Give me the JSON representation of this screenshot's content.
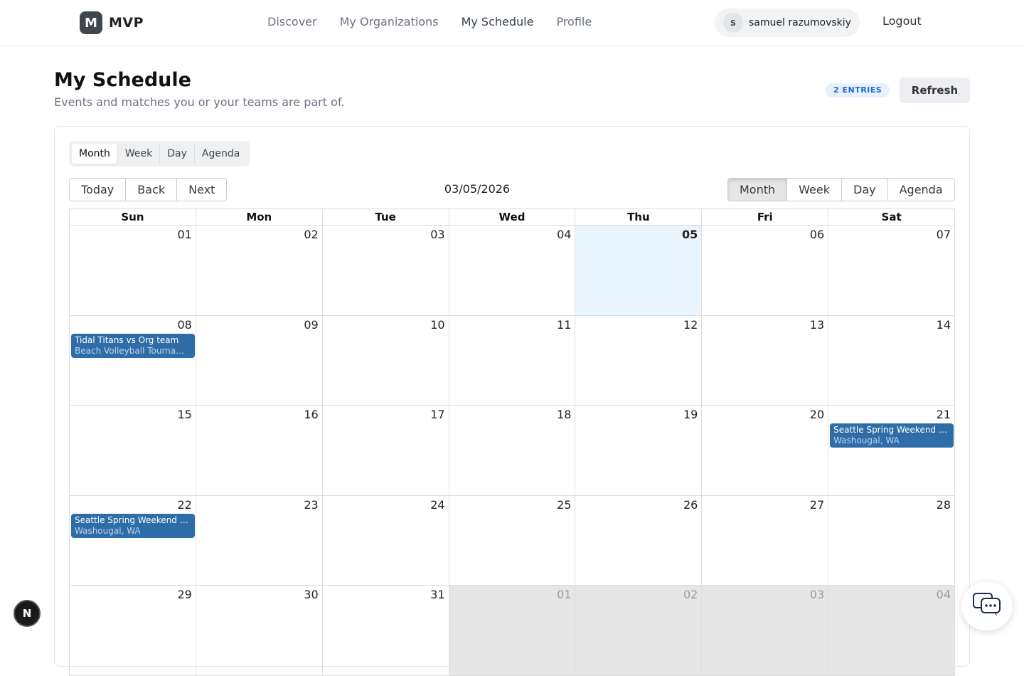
{
  "brand": {
    "mark": "M",
    "name": "MVP"
  },
  "nav": {
    "items": [
      {
        "label": "Discover"
      },
      {
        "label": "My Organizations"
      },
      {
        "label": "My Schedule",
        "active": true
      },
      {
        "label": "Profile"
      }
    ]
  },
  "user": {
    "initial": "S",
    "name": "samuel razumovskiy"
  },
  "logout_label": "Logout",
  "page": {
    "title": "My Schedule",
    "subtitle": "Events and matches you or your teams are part of.",
    "entries_badge": "2 ENTRIES",
    "refresh_label": "Refresh"
  },
  "view_switcher": {
    "items": [
      "Month",
      "Week",
      "Day",
      "Agenda"
    ],
    "selected": "Month"
  },
  "toolbar": {
    "today": "Today",
    "back": "Back",
    "next": "Next",
    "date_label": "03/05/2026",
    "views": [
      "Month",
      "Week",
      "Day",
      "Agenda"
    ],
    "active_view": "Month"
  },
  "calendar": {
    "weekdays": [
      "Sun",
      "Mon",
      "Tue",
      "Wed",
      "Thu",
      "Fri",
      "Sat"
    ],
    "weeks": [
      [
        "01",
        "02",
        "03",
        "04",
        "05",
        "06",
        "07"
      ],
      [
        "08",
        "09",
        "10",
        "11",
        "12",
        "13",
        "14"
      ],
      [
        "15",
        "16",
        "17",
        "18",
        "19",
        "20",
        "21"
      ],
      [
        "22",
        "23",
        "24",
        "25",
        "26",
        "27",
        "28"
      ],
      [
        "29",
        "30",
        "31",
        "01",
        "02",
        "03",
        "04"
      ]
    ],
    "today": "05",
    "events": [
      {
        "week": 1,
        "day": 0,
        "title": "Tidal Titans vs Org team",
        "subtitle": "Beach Volleyball Tournament"
      },
      {
        "week": 2,
        "day": 6,
        "title": "Seattle Spring Weekend Tournament",
        "subtitle": "Washougal, WA"
      },
      {
        "week": 3,
        "day": 0,
        "title": "Seattle Spring Weekend Tournament",
        "subtitle": "Washougal, WA"
      }
    ],
    "event_color": "#2e6da8",
    "today_color": "#eaf6ff"
  },
  "widgets": {
    "dev_badge": "N"
  }
}
